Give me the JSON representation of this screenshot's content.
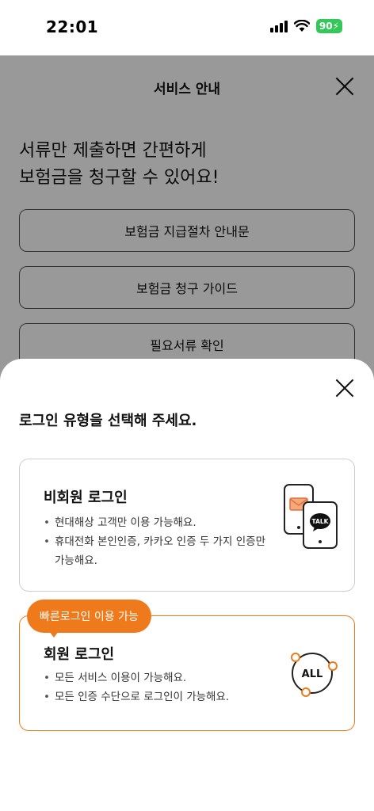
{
  "status_bar": {
    "time": "22:01",
    "battery": "90"
  },
  "page": {
    "title": "서비스 안내",
    "headline_line1": "서류만 제출하면 간편하게",
    "headline_line2": "보험금을 청구할 수 있어요!",
    "buttons": [
      "보험금 지급절차 안내문",
      "보험금 청구 가이드",
      "필요서류 확인"
    ]
  },
  "sheet": {
    "title": "로그인 유형을 선택해 주세요.",
    "guest": {
      "title": "비회원 로그인",
      "bullets": [
        "현대해상 고객만 이용 가능해요.",
        "휴대전화 본인인증, 카카오 인증 두 가지 인증만 가능해요."
      ],
      "icon_text": "TALK"
    },
    "member": {
      "badge": "빠른로그인 이용 가능",
      "title": "회원 로그인",
      "bullets": [
        "모든 서비스 이용이 가능해요.",
        "모든 인증 수단으로 로그인이 가능해요."
      ],
      "icon_text": "ALL"
    }
  },
  "colors": {
    "accent": "#ee7a1c",
    "battery": "#34c759"
  },
  "icons": [
    "signal-icon",
    "wifi-icon",
    "battery-icon",
    "close-icon",
    "phones-kakao-icon",
    "all-auth-icon"
  ]
}
